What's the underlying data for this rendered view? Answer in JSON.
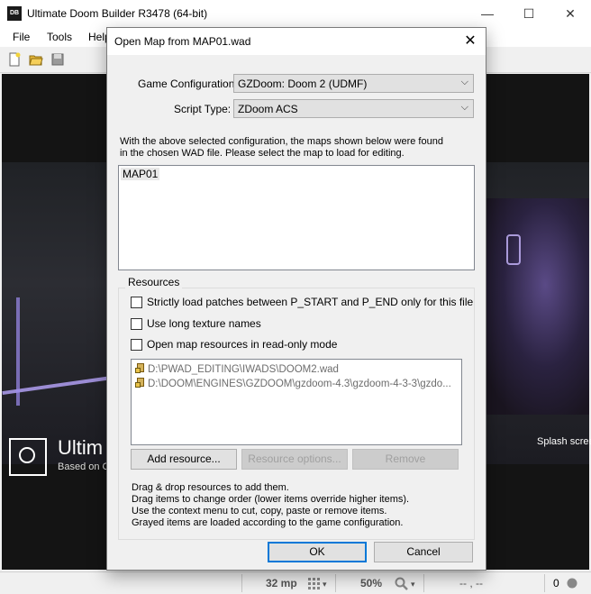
{
  "app": {
    "title": "Ultimate Doom Builder R3478 (64-bit)",
    "icon_text": "DB",
    "window_controls": {
      "minimize": "—",
      "maximize": "☐",
      "close": "✕"
    }
  },
  "menu": {
    "items": [
      "File",
      "Tools",
      "Help"
    ]
  },
  "toolbar": {
    "icons": [
      "new-map-icon",
      "open-map-icon",
      "save-map-icon"
    ]
  },
  "splash": {
    "brand_name": "Ultim",
    "brand_sub": "Based on C",
    "label": "Splash scree"
  },
  "statusbar": {
    "grid": "32 mp",
    "zoom": "50%",
    "coords": "-- , --",
    "count": "0"
  },
  "dialog": {
    "title": "Open Map from MAP01.wad",
    "close": "✕",
    "game_config_label": "Game Configuration:",
    "game_config_value": "GZDoom: Doom 2 (UDMF)",
    "script_type_label": "Script Type:",
    "script_type_value": "ZDoom ACS",
    "info_line1": "With the above selected configuration, the maps shown below were found",
    "info_line2": "in the chosen WAD file. Please select the map to load for editing.",
    "maps": [
      "MAP01"
    ],
    "resources_label": "Resources",
    "check_strict": "Strictly load patches between P_START and P_END only for this file",
    "check_long_names": "Use long texture names",
    "check_readonly": "Open map resources in read-only mode",
    "resources": [
      "D:\\PWAD_EDITING\\IWADS\\DOOM2.wad",
      "D:\\DOOM\\ENGINES\\GZDOOM\\gzdoom-4.3\\gzdoom-4-3-3\\gzdo..."
    ],
    "add_resource": "Add resource...",
    "resource_options": "Resource options...",
    "remove": "Remove",
    "help_lines": [
      "Drag & drop resources to add them.",
      "Drag items to change order (lower items override higher items).",
      "Use the context menu to cut, copy, paste or remove items.",
      "Grayed items are loaded according to the game configuration."
    ],
    "ok": "OK",
    "cancel": "Cancel"
  }
}
